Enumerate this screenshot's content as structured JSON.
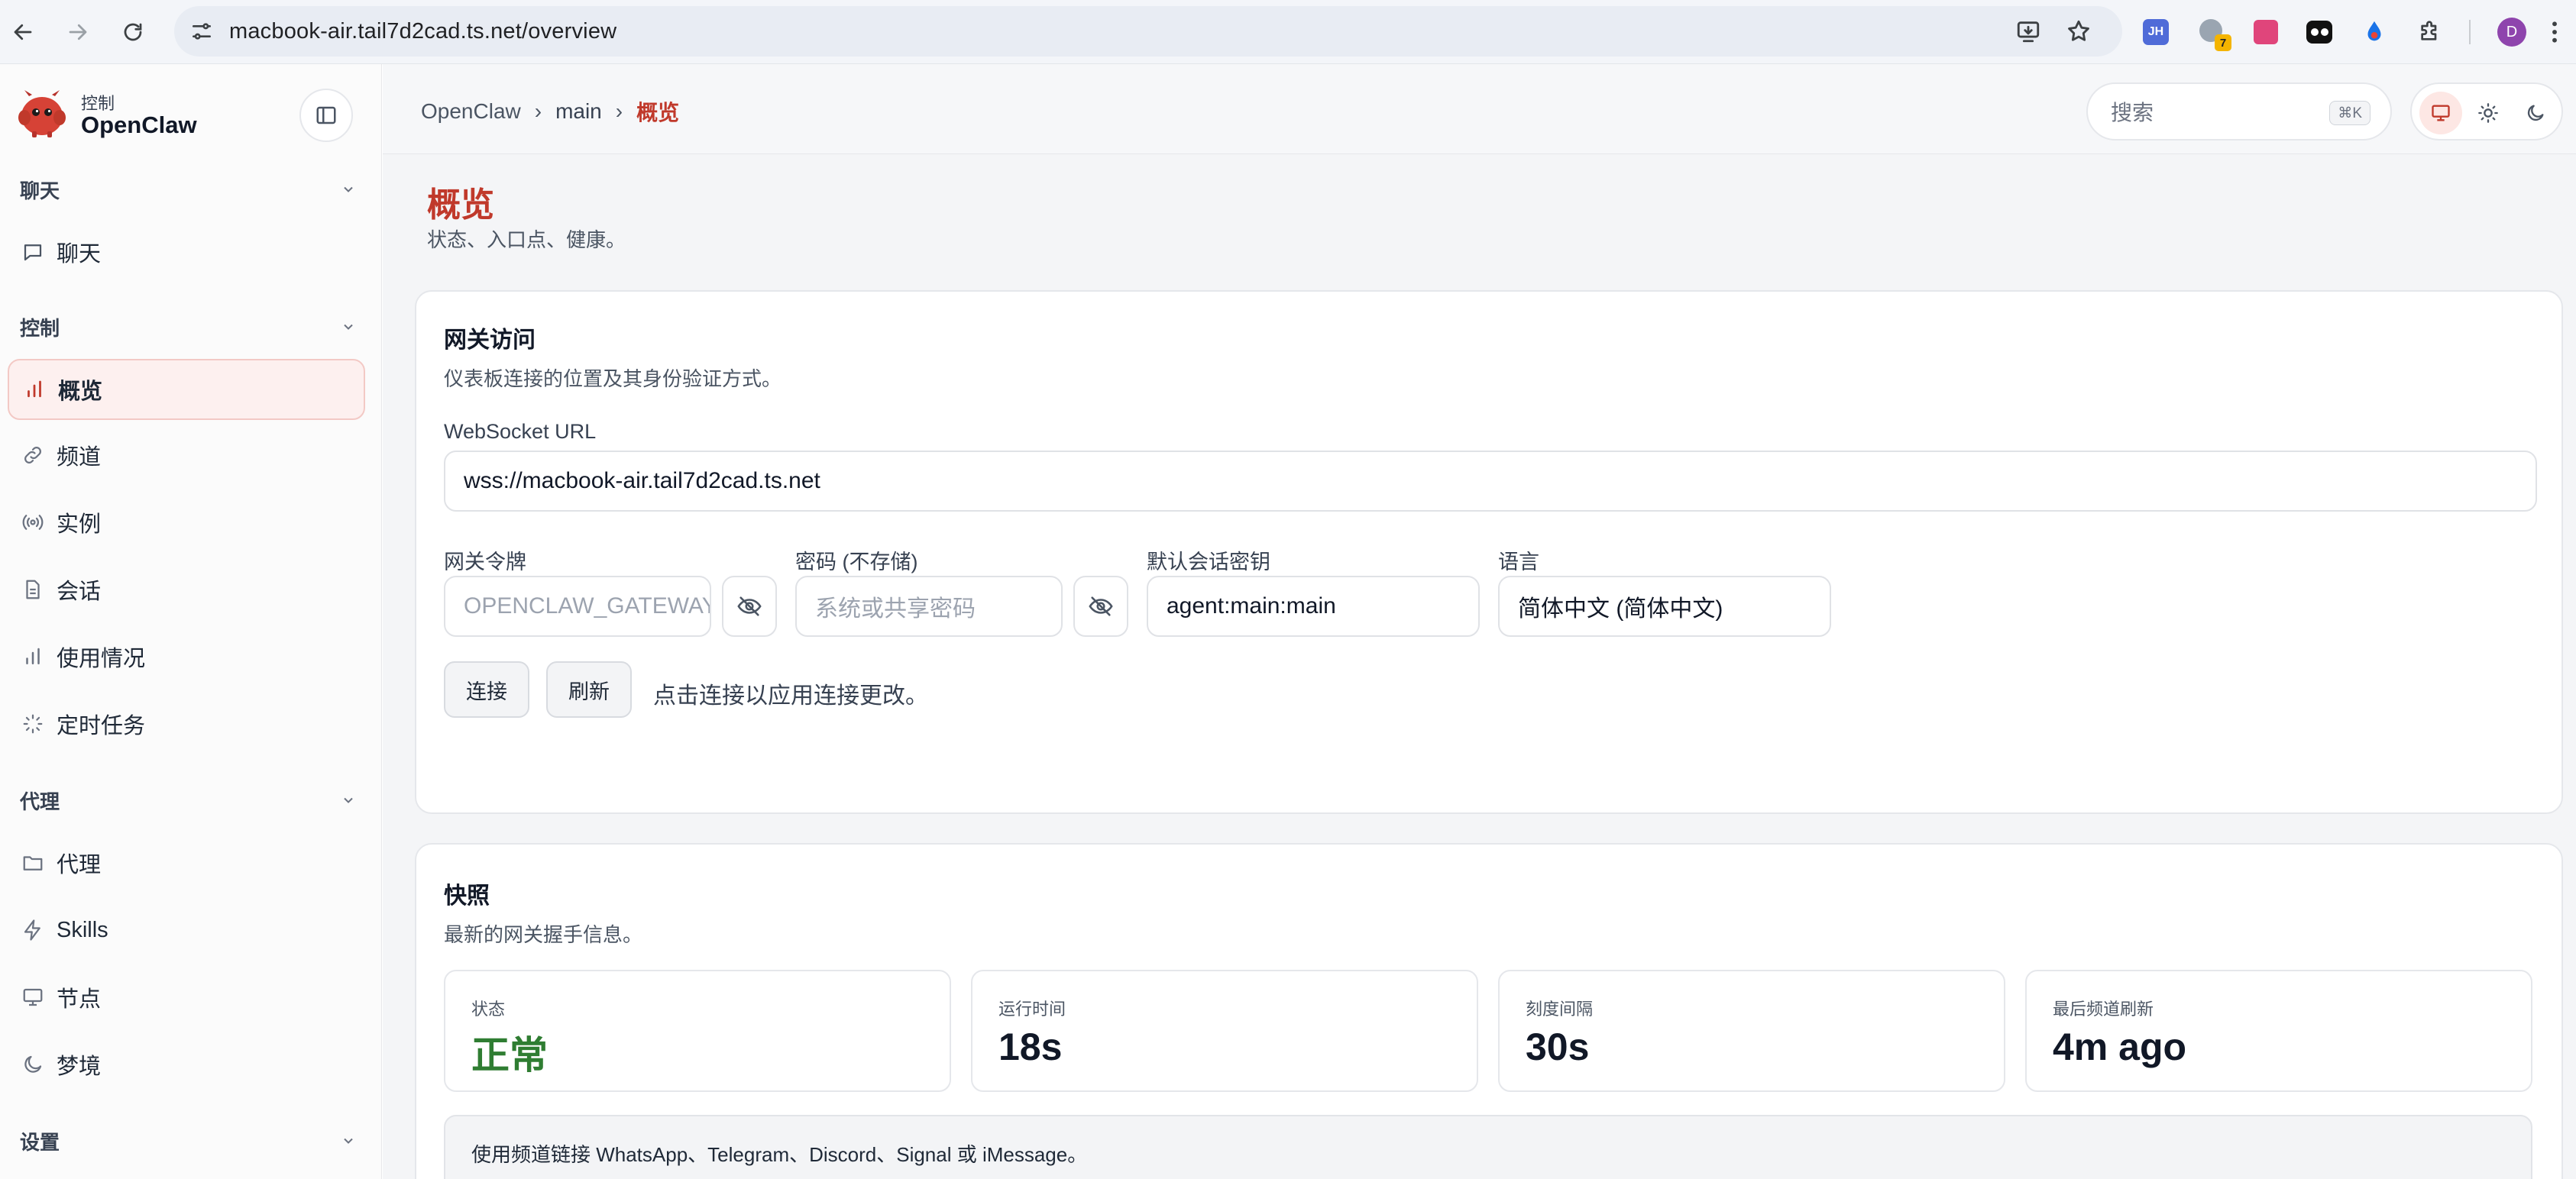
{
  "browser": {
    "url": "macbook-air.tail7d2cad.ts.net/overview",
    "extension_badge": "7",
    "profile_initial": "D",
    "ext_jh_label": "JH"
  },
  "sidebar": {
    "brand_sub": "控制",
    "brand_title": "OpenClaw",
    "sections": [
      {
        "label": "聊天",
        "items": [
          {
            "label": "聊天",
            "icon": "chat-icon"
          }
        ]
      },
      {
        "label": "控制",
        "items": [
          {
            "label": "概览",
            "icon": "bar-chart-icon",
            "active": true
          },
          {
            "label": "频道",
            "icon": "link-icon"
          },
          {
            "label": "实例",
            "icon": "broadcast-icon"
          },
          {
            "label": "会话",
            "icon": "document-icon"
          },
          {
            "label": "使用情况",
            "icon": "bar-chart-icon"
          },
          {
            "label": "定时任务",
            "icon": "loader-icon"
          }
        ]
      },
      {
        "label": "代理",
        "items": [
          {
            "label": "代理",
            "icon": "folder-icon"
          },
          {
            "label": "Skills",
            "icon": "bolt-icon"
          },
          {
            "label": "节点",
            "icon": "monitor-icon"
          },
          {
            "label": "梦境",
            "icon": "moon-icon"
          }
        ]
      },
      {
        "label": "设置",
        "items": []
      }
    ]
  },
  "topbar": {
    "breadcrumb": [
      "OpenClaw",
      "main",
      "概览"
    ],
    "search_placeholder": "搜索",
    "search_shortcut": "⌘K"
  },
  "page": {
    "title": "概览",
    "subtitle": "状态、入口点、健康。"
  },
  "gateway_card": {
    "title": "网关访问",
    "subtitle": "仪表板连接的位置及其身份验证方式。",
    "ws_label": "WebSocket URL",
    "ws_value": "wss://macbook-air.tail7d2cad.ts.net",
    "token_label": "网关令牌",
    "token_placeholder": "OPENCLAW_GATEWAY_TOKEN",
    "password_label": "密码 (不存储)",
    "password_placeholder": "系统或共享密码",
    "session_key_label": "默认会话密钥",
    "session_key_value": "agent:main:main",
    "language_label": "语言",
    "language_value": "简体中文 (简体中文)",
    "connect_label": "连接",
    "refresh_label": "刷新",
    "hint": "点击连接以应用连接更改。"
  },
  "snapshot_card": {
    "title": "快照",
    "subtitle": "最新的网关握手信息。",
    "stats": [
      {
        "label": "状态",
        "value": "正常",
        "status": "ok"
      },
      {
        "label": "运行时间",
        "value": "18s"
      },
      {
        "label": "刻度间隔",
        "value": "30s"
      },
      {
        "label": "最后频道刷新",
        "value": "4m ago"
      }
    ],
    "notice": "使用频道链接 WhatsApp、Telegram、Discord、Signal 或 iMessage。"
  },
  "colors": {
    "accent": "#c0392b",
    "ok": "#2f7d32",
    "active_bg": "#fdf0ef"
  }
}
